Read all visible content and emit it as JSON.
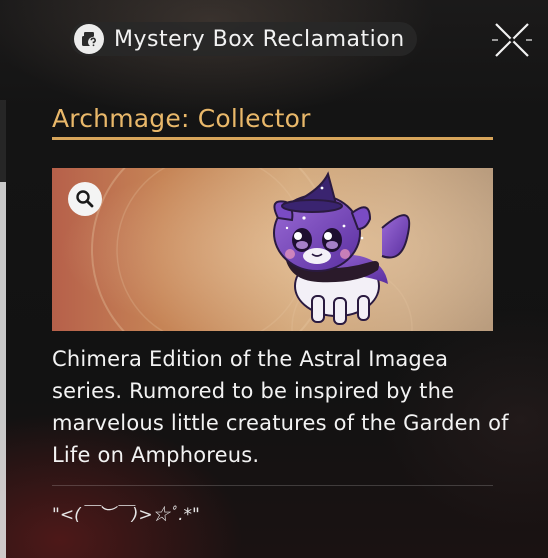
{
  "header": {
    "title": "Mystery Box Reclamation",
    "title_icon": "mystery-box-icon",
    "close_icon": "close-icon"
  },
  "item": {
    "name": "Archmage: Collector",
    "image_subject": "purple starry chimera creature wearing a witch hat",
    "zoom_icon": "magnifier-icon",
    "description": "Chimera Edition of the Astral Imagea series. Rumored to be inspired by the marvelous little creatures of the Garden of Life on Amphoreus.",
    "flavor_text": "\"<(￣︶￣)>☆ﾟ.*\""
  },
  "colors": {
    "accent_gold": "#e9b86a",
    "panel_bg": "#141414",
    "text": "#f3f3f3"
  }
}
